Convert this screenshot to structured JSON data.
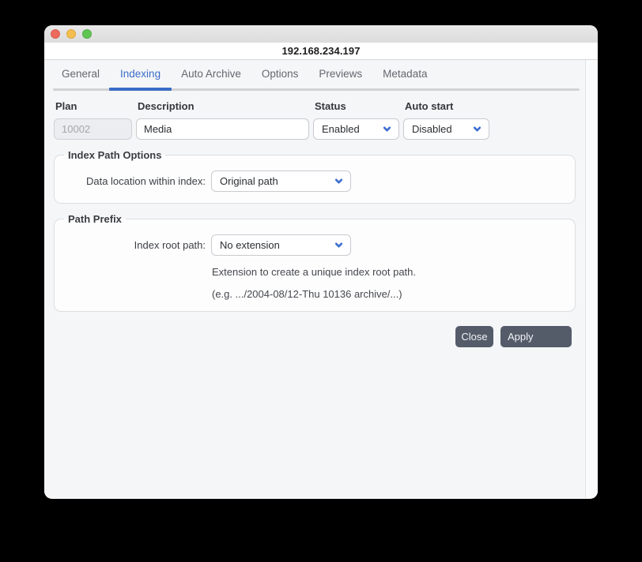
{
  "window": {
    "title": "192.168.234.197"
  },
  "tabs": [
    {
      "label": "General",
      "active": false
    },
    {
      "label": "Indexing",
      "active": true
    },
    {
      "label": "Auto Archive",
      "active": false
    },
    {
      "label": "Options",
      "active": false
    },
    {
      "label": "Previews",
      "active": false
    },
    {
      "label": "Metadata",
      "active": false
    }
  ],
  "form": {
    "plan": {
      "label": "Plan",
      "value": "10002",
      "disabled": true
    },
    "description": {
      "label": "Description",
      "value": "Media"
    },
    "status": {
      "label": "Status",
      "value": "Enabled"
    },
    "auto_start": {
      "label": "Auto start",
      "value": "Disabled"
    }
  },
  "sections": {
    "index_path_options": {
      "legend": "Index Path Options",
      "data_location": {
        "label": "Data location within index:",
        "value": "Original path"
      }
    },
    "path_prefix": {
      "legend": "Path Prefix",
      "index_root": {
        "label": "Index root path:",
        "value": "No extension"
      },
      "hint_line1": "Extension to create a unique index root path.",
      "hint_line2": "(e.g. .../2004-08/12-Thu 10136 archive/...)"
    }
  },
  "actions": {
    "close_label": "Close",
    "apply_label": "Apply"
  },
  "icons": {
    "chevron_down": "chevron-down-icon",
    "traffic_lights": [
      "close",
      "minimize",
      "zoom"
    ]
  },
  "colors": {
    "accent_blue": "#3a6cc6",
    "chevron_blue": "#3b6ed0",
    "button_bg": "#545c6a",
    "traffic_red": "#ed6a5e",
    "traffic_yellow": "#f4bf4f",
    "traffic_green": "#61c554",
    "content_bg": "#f5f6f8",
    "fieldset_bg": "#fdfdfe"
  }
}
